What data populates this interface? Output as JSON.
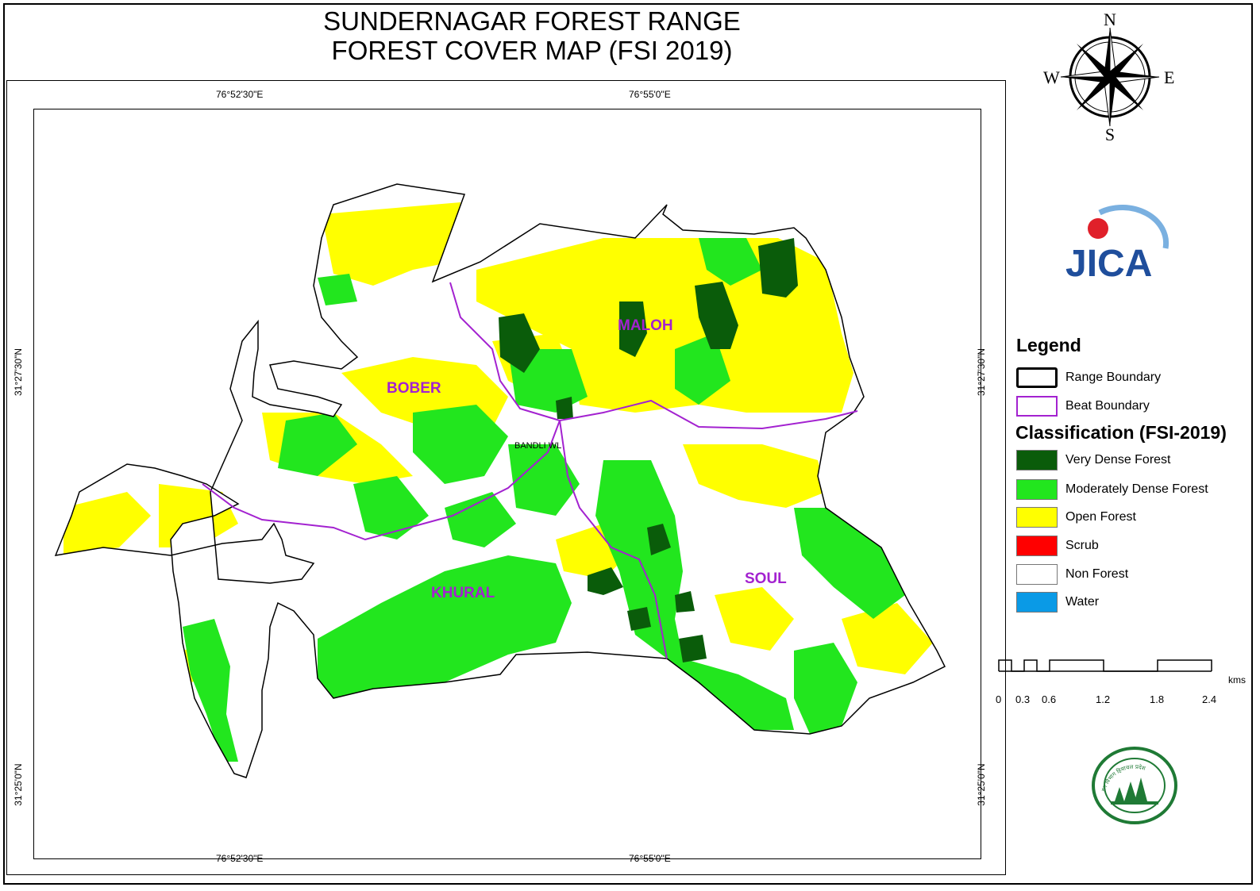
{
  "title": {
    "line1": "SUNDERNAGAR FOREST RANGE",
    "line2": "FOREST COVER MAP (FSI 2019)"
  },
  "coordinates": {
    "lon_left": "76°52'30\"E",
    "lon_right": "76°55'0\"E",
    "lat_top": "31°27'30\"N",
    "lat_bottom": "31°25'0\"N"
  },
  "compass": {
    "n": "N",
    "s": "S",
    "e": "E",
    "w": "W"
  },
  "logo": {
    "jica_text": "JICA",
    "department_text": "वन विभाग हिमाचल प्रदेश"
  },
  "beats": {
    "maloh": "MALOH",
    "bober": "BOBER",
    "khural": "KHURAL",
    "soul": "SOUL"
  },
  "place": {
    "bandli": "BANDLI WL"
  },
  "legend": {
    "title": "Legend",
    "range_boundary": "Range Boundary",
    "beat_boundary": "Beat Boundary",
    "classification_title": "Classification (FSI-2019)",
    "classes": [
      {
        "label": "Very Dense Forest",
        "color": "#0a5c0a"
      },
      {
        "label": "Moderately Dense Forest",
        "color": "#22e61e"
      },
      {
        "label": "Open Forest",
        "color": "#ffff00"
      },
      {
        "label": "Scrub",
        "color": "#ff0000"
      },
      {
        "label": "Non Forest",
        "color": "#ffffff"
      },
      {
        "label": "Water",
        "color": "#0a9ae6"
      }
    ]
  },
  "scale": {
    "ticks": [
      "0",
      "0.3",
      "0.6",
      "1.2",
      "1.8",
      "2.4"
    ],
    "unit": "kms"
  },
  "colors": {
    "beat_boundary": "#a322d0",
    "very_dense": "#0a5c0a",
    "moderately_dense": "#22e61e",
    "open_forest": "#ffff00"
  }
}
